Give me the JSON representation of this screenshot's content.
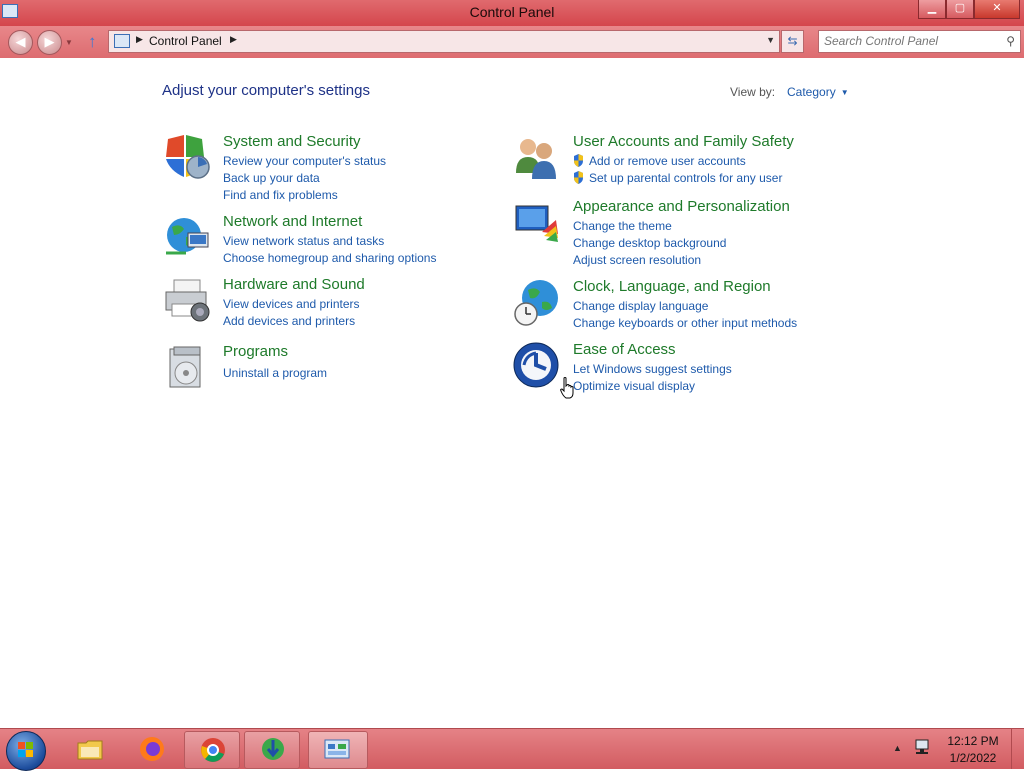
{
  "window": {
    "title": "Control Panel"
  },
  "title_buttons": {
    "minimize": "▁",
    "maximize": "▢",
    "close": "✕"
  },
  "nav": {
    "back_icon": "back-arrow-icon",
    "forward_icon": "forward-arrow-icon",
    "address_path": "Control Panel",
    "search_placeholder": "Search Control Panel"
  },
  "content": {
    "page_title": "Adjust your computer's settings",
    "view_by_label": "View by:",
    "view_by_value": "Category",
    "categories": [
      {
        "title": "System and Security",
        "icon": "shield-icon",
        "links": [
          "Review your computer's status",
          "Back up your data",
          "Find and fix problems"
        ]
      },
      {
        "title": "Network and Internet",
        "icon": "globe-network-icon",
        "links": [
          "View network status and tasks",
          "Choose homegroup and sharing options"
        ]
      },
      {
        "title": "Hardware and Sound",
        "icon": "printer-icon",
        "links": [
          "View devices and printers",
          "Add devices and printers"
        ]
      },
      {
        "title": "Programs",
        "icon": "programs-icon",
        "links": [
          "Uninstall a program"
        ]
      },
      {
        "title": "User Accounts and Family Safety",
        "icon": "users-icon",
        "links": [
          "Add or remove user accounts",
          "Set up parental controls for any user"
        ]
      },
      {
        "title": "Appearance and Personalization",
        "icon": "monitor-paint-icon",
        "links": [
          "Change the theme",
          "Change desktop background",
          "Adjust screen resolution"
        ]
      },
      {
        "title": "Clock, Language, and Region",
        "icon": "clock-globe-icon",
        "links": [
          "Change display language",
          "Change keyboards or other input methods"
        ]
      },
      {
        "title": "Ease of Access",
        "icon": "ease-of-access-icon",
        "links": [
          "Let Windows suggest settings",
          "Optimize visual display"
        ]
      }
    ]
  },
  "taskbar": {
    "items": [
      "start-orb-icon",
      "file-explorer-icon",
      "firefox-icon",
      "chrome-icon",
      "idm-icon",
      "control-panel-icon"
    ],
    "clock_time": "12:12 PM",
    "clock_date": "1/2/2022"
  },
  "colors": {
    "accent": "#d4464c",
    "link": "#1e5aab",
    "category_title": "#1e7a2a",
    "heading": "#1e3287"
  }
}
